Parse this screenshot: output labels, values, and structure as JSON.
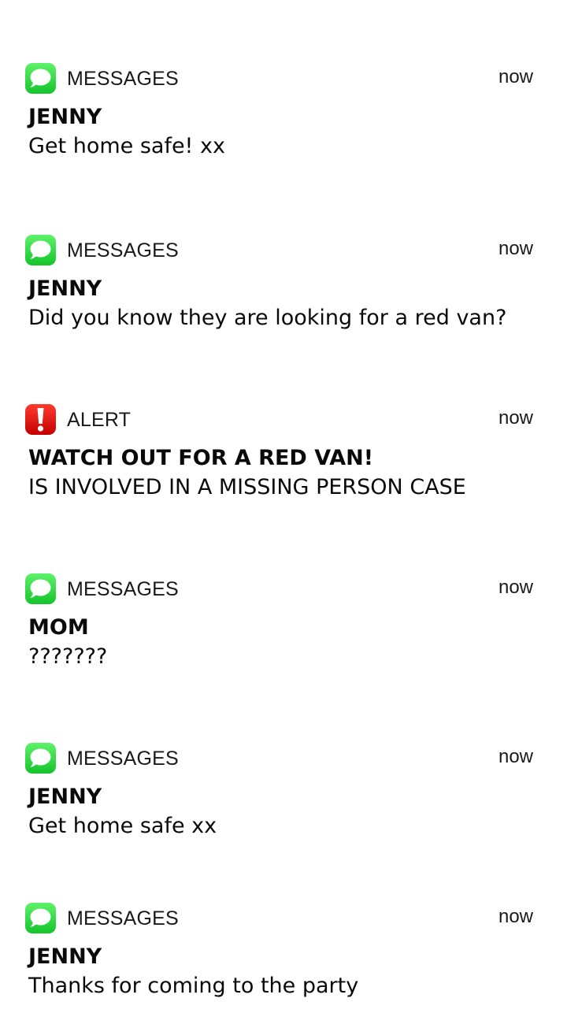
{
  "notifications": [
    {
      "app": "MESSAGES",
      "icon": "messages-icon",
      "time": "now",
      "title": "JENNY",
      "body": "Get home safe! xx"
    },
    {
      "app": "MESSAGES",
      "icon": "messages-icon",
      "time": "now",
      "title": "JENNY",
      "body": "Did you know they are looking for a red van?"
    },
    {
      "app": "ALERT",
      "icon": "alert-icon",
      "time": "now",
      "title": "WATCH OUT FOR A RED VAN!",
      "body": "IS INVOLVED IN A MISSING PERSON CASE"
    },
    {
      "app": "MESSAGES",
      "icon": "messages-icon",
      "time": "now",
      "title": "MOM",
      "body": "???????"
    },
    {
      "app": "MESSAGES",
      "icon": "messages-icon",
      "time": "now",
      "title": "JENNY",
      "body": "Get home safe xx"
    },
    {
      "app": "MESSAGES",
      "icon": "messages-icon",
      "time": "now",
      "title": "JENNY",
      "body": "Thanks for coming to the party"
    }
  ],
  "colors": {
    "messages_green_top": "#5ef26a",
    "messages_green_bottom": "#14c42b",
    "alert_red_top": "#ff3b2f",
    "alert_red_bottom": "#c40000"
  }
}
